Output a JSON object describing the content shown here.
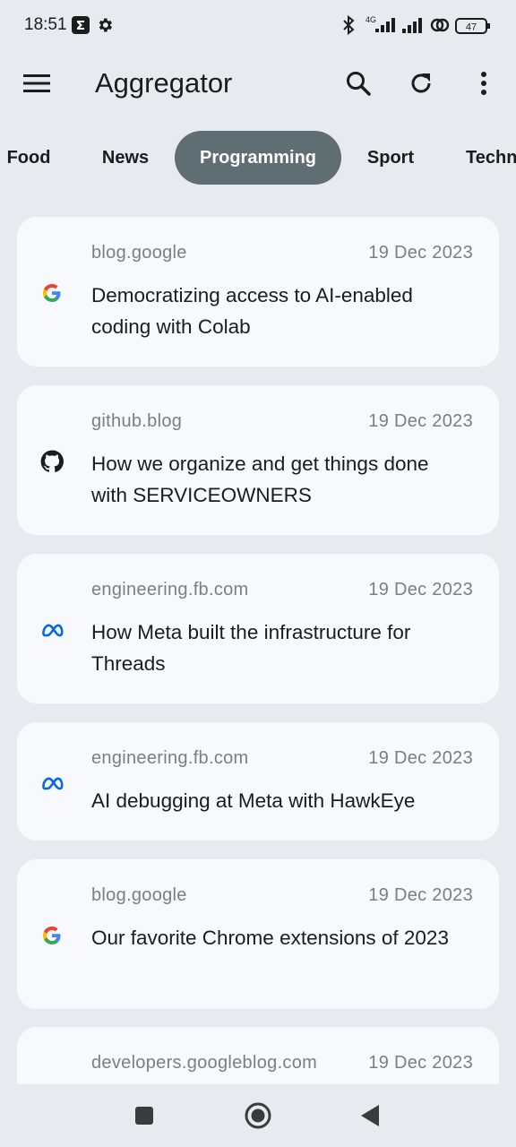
{
  "status_bar": {
    "time": "18:51",
    "network": "4G",
    "battery": "47",
    "icons": [
      "sigma-app-icon",
      "settings-gear-icon",
      "bluetooth-icon",
      "signal-4g-icon",
      "signal-icon",
      "link-icon",
      "battery-icon"
    ]
  },
  "app_bar": {
    "title": "Aggregator",
    "icons": [
      "menu-icon",
      "search-icon",
      "refresh-icon",
      "more-vert-icon"
    ]
  },
  "tabs": [
    {
      "label": "Food"
    },
    {
      "label": "News"
    },
    {
      "label": "Programming",
      "active": true
    },
    {
      "label": "Sport"
    },
    {
      "label": "Technology"
    }
  ],
  "articles": [
    {
      "source": "blog.google",
      "date": "19 Dec 2023",
      "title": "Democratizing access to AI-enabled coding with Colab",
      "logo": "google-logo-icon"
    },
    {
      "source": "github.blog",
      "date": "19 Dec 2023",
      "title": "How we organize and get things done with SERVICEOWNERS",
      "logo": "github-logo-icon"
    },
    {
      "source": "engineering.fb.com",
      "date": "19 Dec 2023",
      "title": "How Meta built the infrastructure for Threads",
      "logo": "meta-logo-icon"
    },
    {
      "source": "engineering.fb.com",
      "date": "19 Dec 2023",
      "title": "AI debugging at Meta with HawkEye",
      "logo": "meta-logo-icon"
    },
    {
      "source": "blog.google",
      "date": "19 Dec 2023",
      "title": "Our favorite Chrome extensions of 2023",
      "logo": "google-logo-icon"
    },
    {
      "source": "developers.googleblog.com",
      "date": "19 Dec 2023",
      "title": "",
      "logo": ""
    }
  ],
  "nav_bar": {
    "icons": [
      "recents-square-icon",
      "home-circle-icon",
      "back-triangle-icon"
    ]
  },
  "colors": {
    "background": "#e7eaee",
    "card": "#f7f9fc",
    "active_tab": "#5f6e72",
    "muted_text": "#7b7e83"
  }
}
